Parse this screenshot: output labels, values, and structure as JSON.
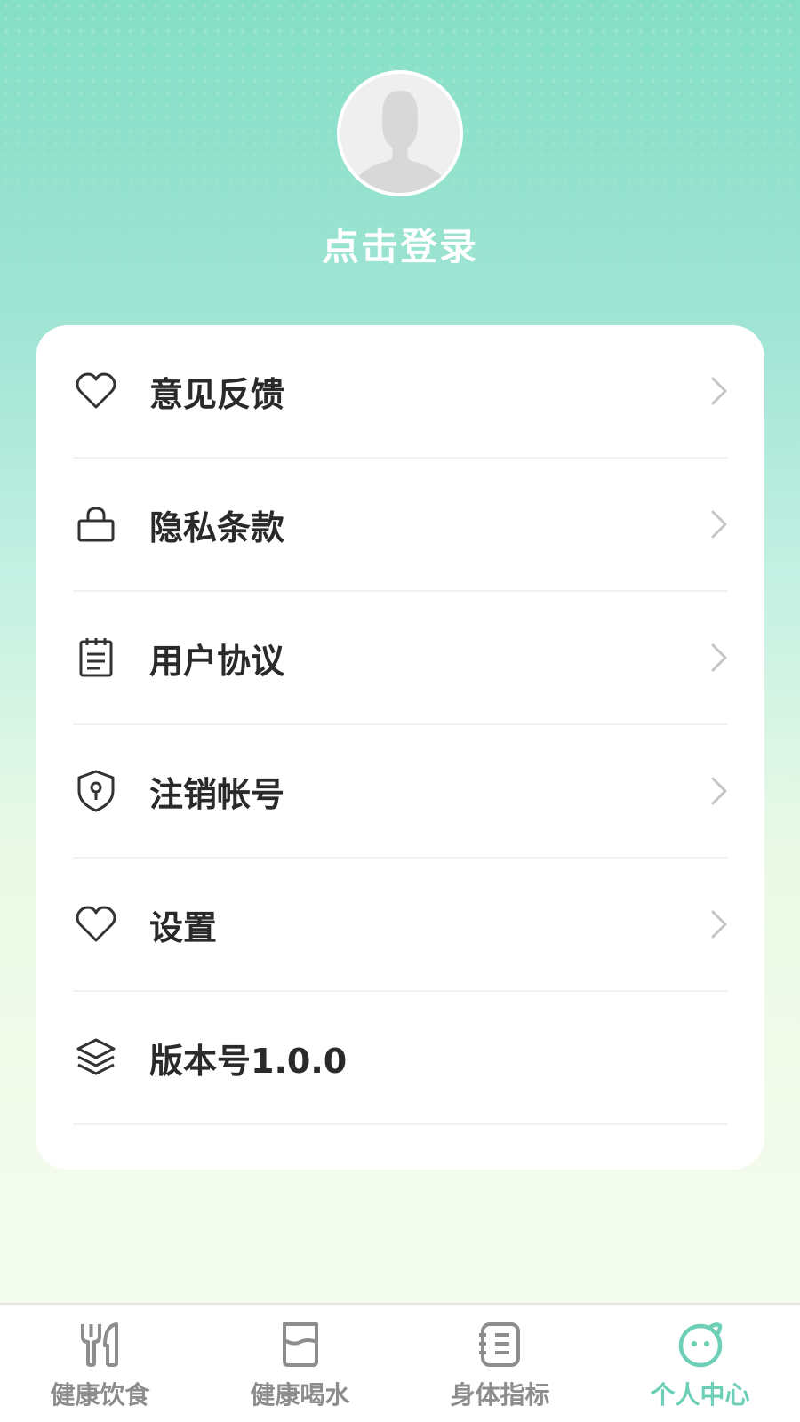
{
  "header": {
    "login_text": "点击登录"
  },
  "menu": [
    {
      "label": "意见反馈",
      "icon": "heart-icon"
    },
    {
      "label": "隐私条款",
      "icon": "lock-icon"
    },
    {
      "label": "用户协议",
      "icon": "document-icon"
    },
    {
      "label": "注销帐号",
      "icon": "shield-icon"
    },
    {
      "label": "设置",
      "icon": "heart-icon"
    },
    {
      "label": "版本号1.0.0",
      "icon": "layers-icon"
    }
  ],
  "tabbar": [
    {
      "label": "健康饮食",
      "icon": "fork-knife-icon",
      "active": false
    },
    {
      "label": "健康喝水",
      "icon": "water-glass-icon",
      "active": false
    },
    {
      "label": "身体指标",
      "icon": "notebook-icon",
      "active": false
    },
    {
      "label": "个人中心",
      "icon": "face-icon",
      "active": true
    }
  ],
  "colors": {
    "accent": "#6ccfb6",
    "inactive_tab": "#8d8d8d",
    "text": "#2a2a2a"
  }
}
